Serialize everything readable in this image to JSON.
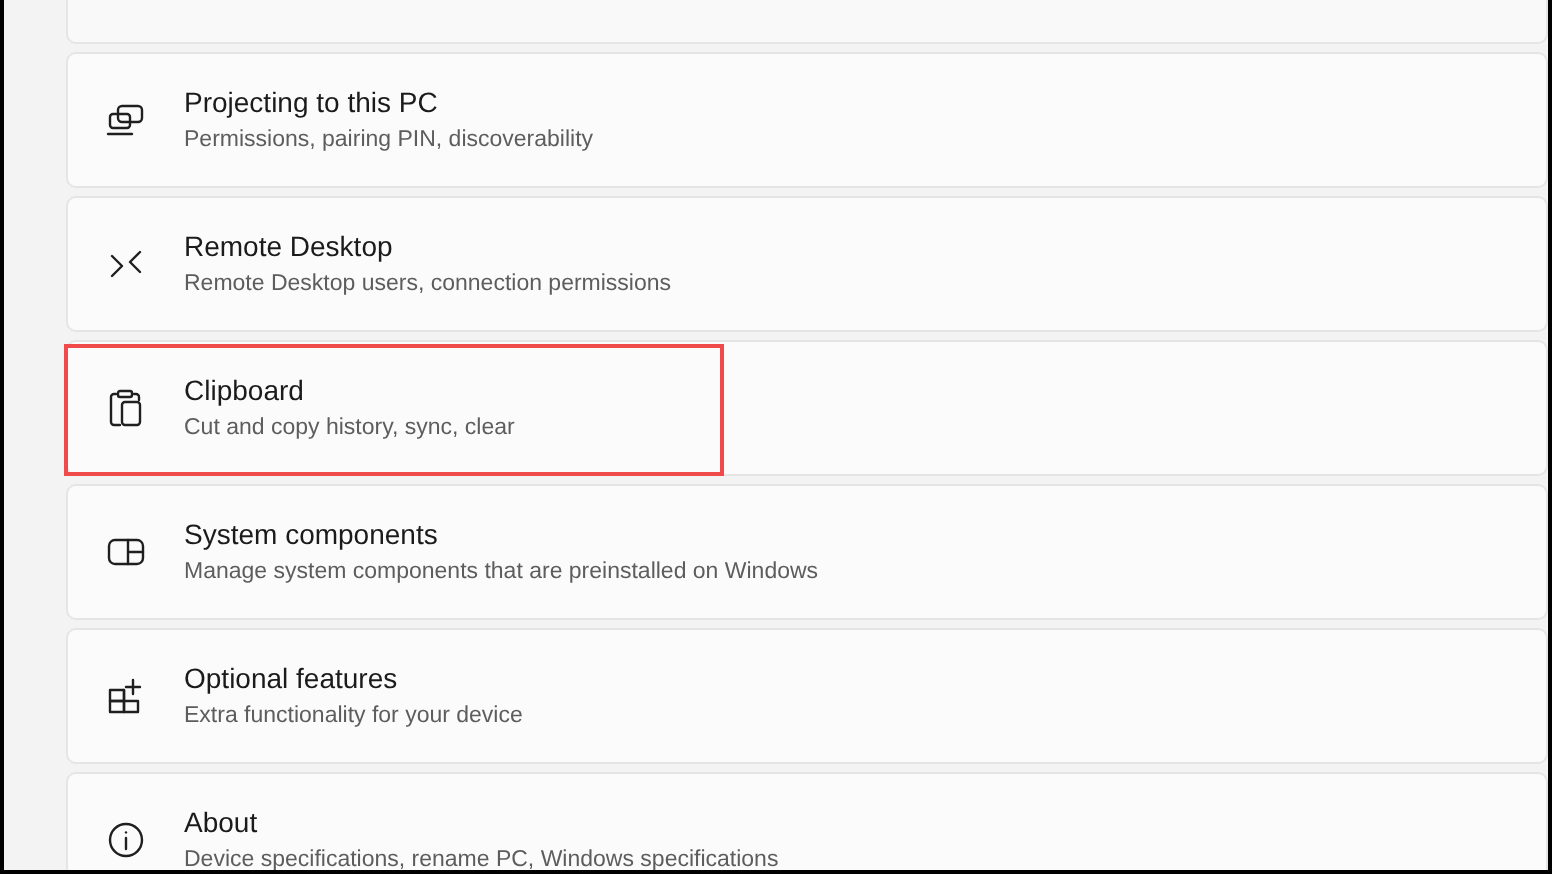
{
  "items": [
    {
      "kind": "projector",
      "title": "Projecting to this PC",
      "subtitle": "Permissions, pairing PIN, discoverability",
      "highlighted": false
    },
    {
      "kind": "remote",
      "title": "Remote Desktop",
      "subtitle": "Remote Desktop users, connection permissions",
      "highlighted": false
    },
    {
      "kind": "clipboard",
      "title": "Clipboard",
      "subtitle": "Cut and copy history, sync, clear",
      "highlighted": true
    },
    {
      "kind": "components",
      "title": "System components",
      "subtitle": "Manage system components that are preinstalled on Windows",
      "highlighted": false
    },
    {
      "kind": "features",
      "title": "Optional features",
      "subtitle": "Extra functionality for your device",
      "highlighted": false
    },
    {
      "kind": "info",
      "title": "About",
      "subtitle": "Device specifications, rename PC, Windows specifications",
      "highlighted": false
    }
  ]
}
